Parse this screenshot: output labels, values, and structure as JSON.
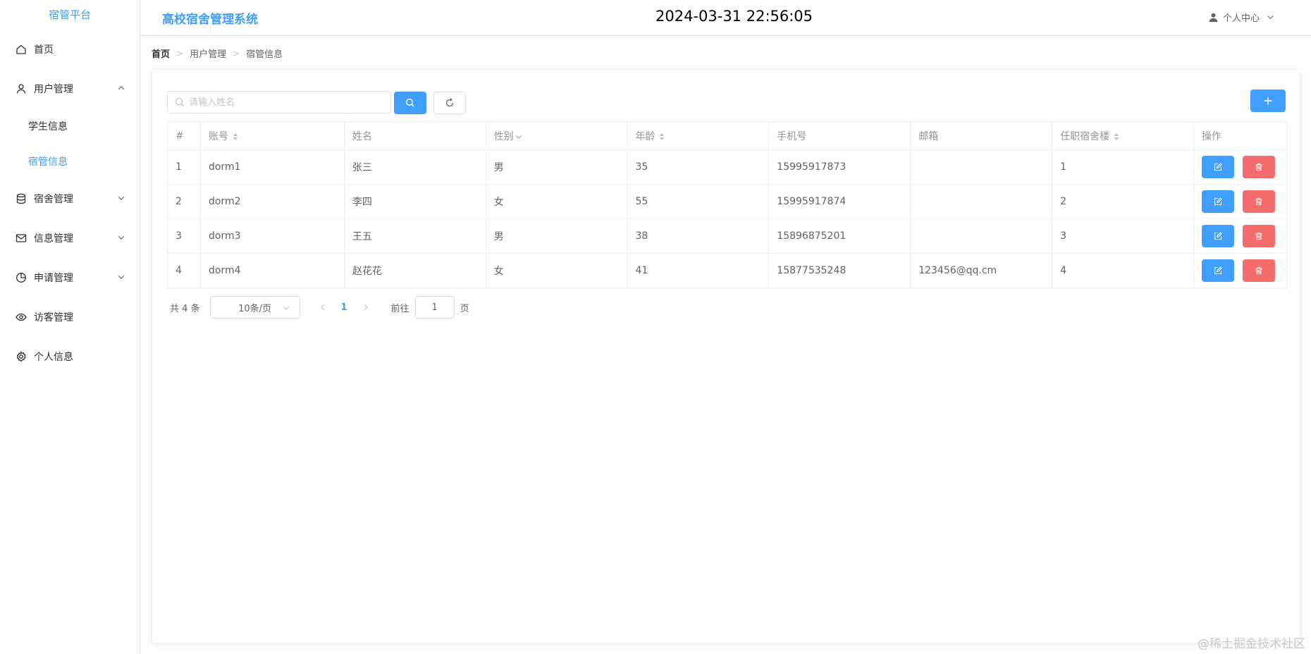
{
  "sidebar": {
    "brand": "宿管平台",
    "items": [
      {
        "label": "首页",
        "icon": "home-icon"
      },
      {
        "label": "用户管理",
        "icon": "user-icon",
        "expanded": true,
        "children": [
          {
            "label": "学生信息",
            "active": false
          },
          {
            "label": "宿管信息",
            "active": true
          }
        ]
      },
      {
        "label": "宿舍管理",
        "icon": "database-icon",
        "expanded": false
      },
      {
        "label": "信息管理",
        "icon": "mail-icon",
        "expanded": false
      },
      {
        "label": "申请管理",
        "icon": "pie-chart-icon",
        "expanded": false
      },
      {
        "label": "访客管理",
        "icon": "eye-icon"
      },
      {
        "label": "个人信息",
        "icon": "gear-icon"
      }
    ]
  },
  "header": {
    "title": "高校宿舍管理系统",
    "datetime": "2024-03-31 22:56:05",
    "user_menu": "个人中心"
  },
  "breadcrumb": [
    "首页",
    "用户管理",
    "宿管信息"
  ],
  "search": {
    "placeholder": "请输入姓名",
    "value": ""
  },
  "table": {
    "columns": [
      "#",
      "账号",
      "姓名",
      "性别",
      "年龄",
      "手机号",
      "邮箱",
      "任职宿舍楼",
      "操作"
    ],
    "rows": [
      {
        "index": "1",
        "account": "dorm1",
        "name": "张三",
        "gender": "男",
        "age": "35",
        "phone": "15995917873",
        "email": "",
        "building": "1"
      },
      {
        "index": "2",
        "account": "dorm2",
        "name": "李四",
        "gender": "女",
        "age": "55",
        "phone": "15995917874",
        "email": "",
        "building": "2"
      },
      {
        "index": "3",
        "account": "dorm3",
        "name": "王五",
        "gender": "男",
        "age": "38",
        "phone": "15896875201",
        "email": "",
        "building": "3"
      },
      {
        "index": "4",
        "account": "dorm4",
        "name": "赵花花",
        "gender": "女",
        "age": "41",
        "phone": "15877535248",
        "email": "123456@qq.cm",
        "building": "4"
      }
    ]
  },
  "pagination": {
    "total_label": "共 4 条",
    "page_size": "10条/页",
    "current_page": "1",
    "goto_label": "前往",
    "goto_value": "1",
    "page_unit": "页"
  },
  "watermark": "@稀土掘金技术社区",
  "colors": {
    "primary": "#409eff",
    "danger": "#f56c6c",
    "border": "#ebeef5"
  }
}
